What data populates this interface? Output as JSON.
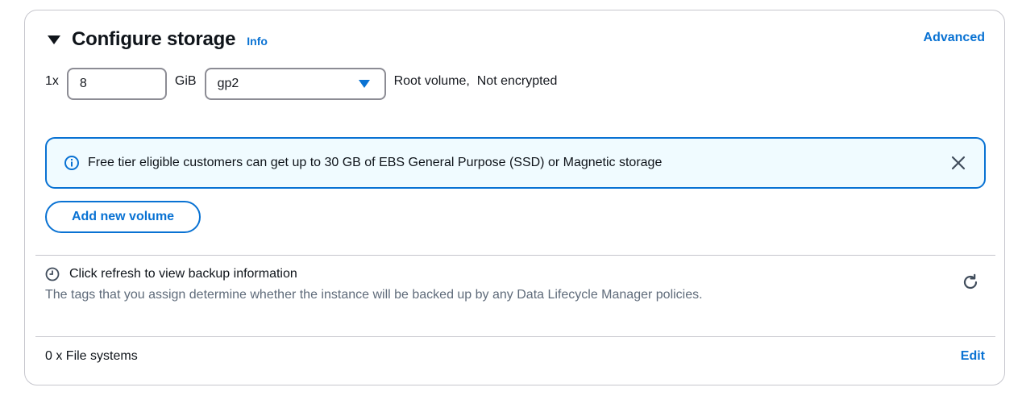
{
  "section": {
    "title": "Configure storage",
    "info_label": "Info",
    "advanced_label": "Advanced"
  },
  "volume": {
    "count_label": "1x",
    "size_value": "8",
    "unit_label": "GiB",
    "type_value": "gp2",
    "description": "Root volume,  Not encrypted"
  },
  "alert": {
    "message": "Free tier eligible customers can get up to 30 GB of EBS General Purpose (SSD) or Magnetic storage"
  },
  "add_volume_label": "Add new volume",
  "backup": {
    "title": "Click refresh to view backup information",
    "description": "The tags that you assign determine whether the instance will be backed up by any Data Lifecycle Manager policies."
  },
  "file_systems": {
    "label": "0 x File systems",
    "edit_label": "Edit"
  },
  "colors": {
    "accent": "#0972d3",
    "alert_bg": "#f0fbff",
    "muted_text": "#5f6b7a"
  }
}
